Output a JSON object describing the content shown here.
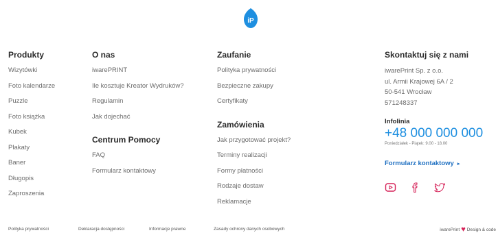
{
  "brand": {
    "logo_text": "iP",
    "logo_color": "#1e8fe0"
  },
  "columns": {
    "products": {
      "heading": "Produkty",
      "items": [
        "Wizytówki",
        "Foto kalendarze",
        "Puzzle",
        "Foto książka",
        "Kubek",
        "Plakaty",
        "Baner",
        "Długopis",
        "Zaproszenia"
      ]
    },
    "about": {
      "heading": "O nas",
      "items": [
        "iwarePRINT",
        "Ile kosztuje Kreator Wydruków?",
        "Regulamin",
        "Jak dojechać"
      ]
    },
    "help": {
      "heading": "Centrum Pomocy",
      "items": [
        "FAQ",
        "Formularz kontaktowy"
      ]
    },
    "trust": {
      "heading": "Zaufanie",
      "items": [
        "Polityka prywatności",
        "Bezpieczne zakupy",
        "Certyfikaty"
      ]
    },
    "orders": {
      "heading": "Zamówienia",
      "items": [
        "Jak przygotować projekt?",
        "Terminy realizacji",
        "Formy płatności",
        "Rodzaje dostaw",
        "Reklamacje"
      ]
    },
    "contact": {
      "heading": "Skontaktuj się z nami",
      "address": [
        "iwarePrint Sp. z o.o.",
        "ul. Armii Krajowej 6A / 2",
        "50-541 Wrocław",
        "571248337"
      ],
      "hotline_label": "Infolinia",
      "phone": "+48 000 000 000",
      "hours": "Poniedziałek - Piątek: 9.00 - 18.00",
      "form_link": "Formularz kontaktowy",
      "form_arrow": "▸",
      "socials": [
        "youtube-icon",
        "facebook-icon",
        "twitter-icon"
      ]
    }
  },
  "bottom_bar": {
    "links": [
      "Polityka prywatności",
      "Deklaracja dostępności",
      "Informacje prawne",
      "Zasady ochrony danych osobowych"
    ],
    "credit_left": "iwarePrint",
    "credit_heart": "♥",
    "credit_right": "Design & code"
  },
  "colors": {
    "accent_blue": "#1e8fe0",
    "link_blue": "#1e6fc1",
    "social_pink": "#d6245a",
    "heart_red": "#d6245a"
  }
}
